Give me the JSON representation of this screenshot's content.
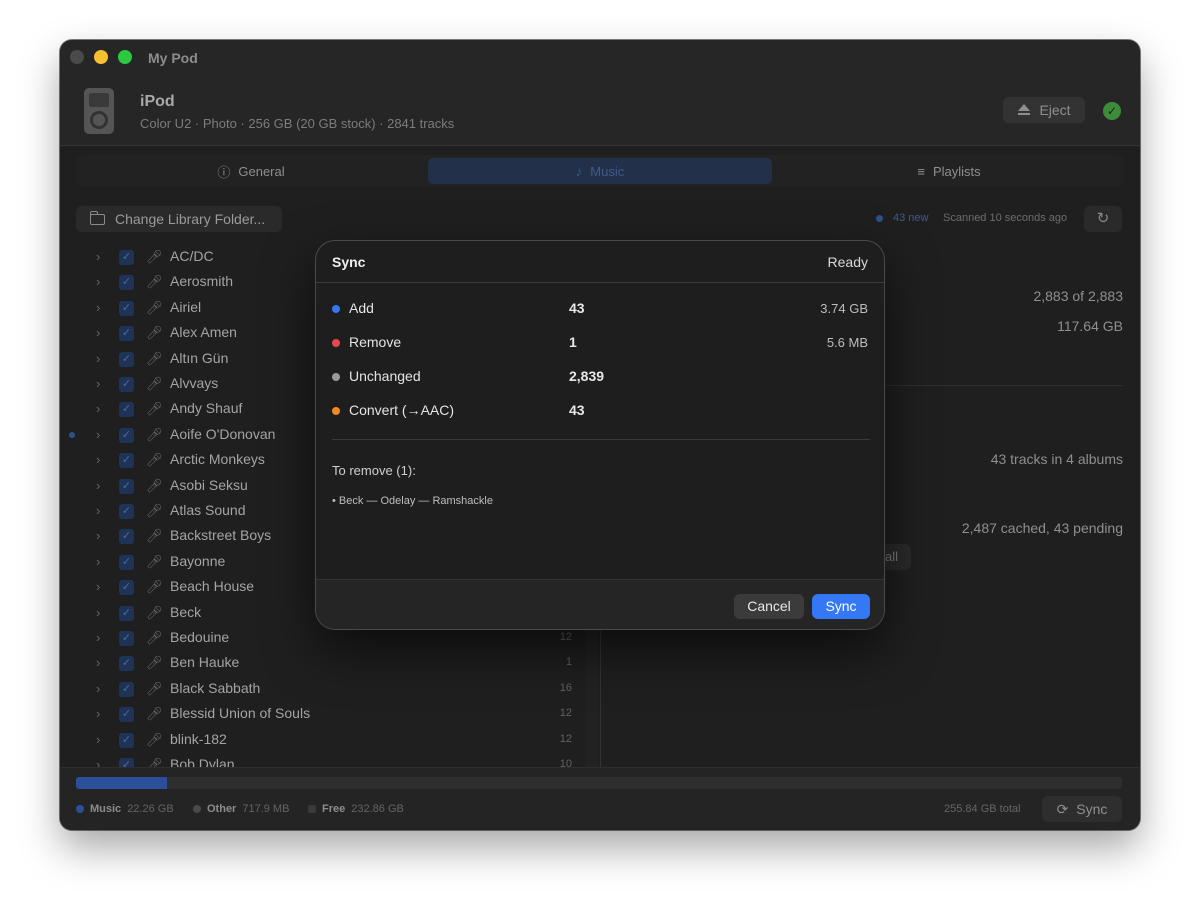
{
  "window": {
    "title": "My Pod"
  },
  "device": {
    "name": "iPod",
    "subtitle": "Color U2 · Photo · 256 GB (20 GB stock) · 2841 tracks",
    "eject_label": "Eject",
    "connected_icon": "check-circle-icon"
  },
  "tabs": [
    {
      "label": "General",
      "icon": "info-icon",
      "active": false
    },
    {
      "label": "Music",
      "icon": "music-note-icon",
      "active": true
    },
    {
      "label": "Playlists",
      "icon": "playlist-icon",
      "active": false
    }
  ],
  "toolbar": {
    "change_folder_label": "Change Library Folder...",
    "new_count": "43 new",
    "scanned": "Scanned 10 seconds ago"
  },
  "artists": [
    {
      "name": "AC/DC",
      "count": "",
      "new": false
    },
    {
      "name": "Aerosmith",
      "count": "",
      "new": false
    },
    {
      "name": "Airiel",
      "count": "",
      "new": false
    },
    {
      "name": "Alex Amen",
      "count": "",
      "new": false
    },
    {
      "name": "Altın Gün",
      "count": "",
      "new": false
    },
    {
      "name": "Alvvays",
      "count": "",
      "new": false
    },
    {
      "name": "Andy Shauf",
      "count": "",
      "new": false
    },
    {
      "name": "Aoife O'Donovan",
      "count": "",
      "new": true
    },
    {
      "name": "Arctic Monkeys",
      "count": "",
      "new": false
    },
    {
      "name": "Asobi Seksu",
      "count": "",
      "new": false
    },
    {
      "name": "Atlas Sound",
      "count": "",
      "new": false
    },
    {
      "name": "Backstreet Boys",
      "count": "",
      "new": false
    },
    {
      "name": "Bayonne",
      "count": "",
      "new": false
    },
    {
      "name": "Beach House",
      "count": "",
      "new": false
    },
    {
      "name": "Beck",
      "count": "",
      "new": false
    },
    {
      "name": "Bedouine",
      "count": "12",
      "new": false
    },
    {
      "name": "Ben Hauke",
      "count": "1",
      "new": false
    },
    {
      "name": "Black Sabbath",
      "count": "16",
      "new": false
    },
    {
      "name": "Blessid Union of Souls",
      "count": "12",
      "new": false
    },
    {
      "name": "blink-182",
      "count": "12",
      "new": false
    },
    {
      "name": "Bob Dylan",
      "count": "10",
      "new": false
    }
  ],
  "right_panel": {
    "selected": "2,883 of 2,883",
    "size": "117.64 GB",
    "new_tracks": "43 tracks in 4 albums",
    "cache": "2,487 cached, 43 pending",
    "button_fragment": "all"
  },
  "storage": {
    "music_fraction": 0.087,
    "legend": [
      {
        "label": "Music",
        "value": "22.26 GB",
        "color": "#2b4f9a"
      },
      {
        "label": "Other",
        "value": "717.9 MB",
        "color": "#4a4a4a"
      },
      {
        "label": "Free",
        "value": "232.86 GB",
        "color": "#3a3a3a"
      }
    ],
    "total": "255.84 GB total",
    "sync_label": "Sync"
  },
  "modal": {
    "title": "Sync",
    "status": "Ready",
    "rows": [
      {
        "label": "Add",
        "count": "43",
        "size": "3.74 GB",
        "color": "#3478f6"
      },
      {
        "label": "Remove",
        "count": "1",
        "size": "5.6 MB",
        "color": "#e5484d"
      },
      {
        "label": "Unchanged",
        "count": "2,839",
        "size": "",
        "color": "#9a9a9a"
      },
      {
        "label": "Convert (→AAC)",
        "count": "43",
        "size": "",
        "color": "#f08a24"
      }
    ],
    "remove_title": "To remove (1):",
    "remove_items": [
      "• Beck — Odelay — Ramshackle"
    ],
    "cancel_label": "Cancel",
    "sync_label": "Sync"
  }
}
